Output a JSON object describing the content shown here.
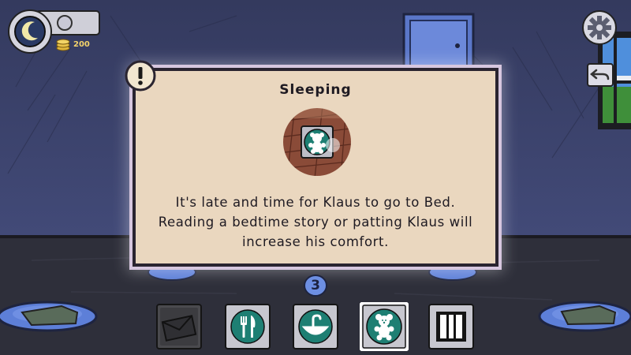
{
  "hud": {
    "coins": "200",
    "level_badge": "3"
  },
  "dialog": {
    "title": "Sleeping",
    "body_line1": "It's late and time for Klaus to go to Bed.",
    "body_line2": "Reading a bedtime story or patting Klaus will",
    "body_line3": "increase his comfort.",
    "icon": "teddy-bear-icon"
  },
  "toolbar": {
    "items": [
      {
        "icon": "envelope-icon",
        "state": "disabled"
      },
      {
        "icon": "fork-knife-icon",
        "state": "available"
      },
      {
        "icon": "sink-icon",
        "state": "available"
      },
      {
        "icon": "teddy-bear-icon",
        "state": "selected"
      },
      {
        "icon": "window-icon",
        "state": "available"
      }
    ]
  },
  "colors": {
    "teal": "#1e7f73",
    "panel": "#ead7bf",
    "wall": "#3b4268",
    "floor": "#2e2e38"
  }
}
